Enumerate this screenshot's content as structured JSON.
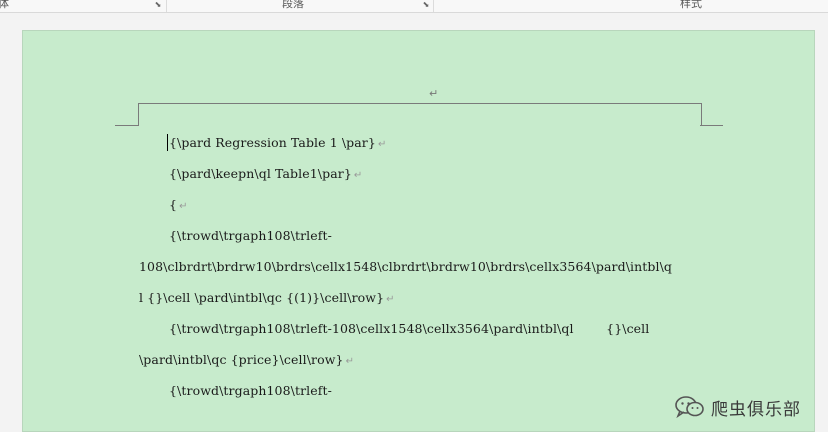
{
  "ribbon": {
    "groups": [
      {
        "label": "体"
      },
      {
        "label": "段落"
      },
      {
        "label": "样式"
      }
    ]
  },
  "document": {
    "header_mark": "↵",
    "lines": [
      {
        "text": "{\\pard Regression Table 1 \\par}",
        "indent": true
      },
      {
        "text": "{\\pard\\keepn\\ql Table1\\par}",
        "indent": true
      },
      {
        "text": "{",
        "indent": true
      },
      {
        "text": "{\\trowd\\trgaph108\\trleft-",
        "indent": true,
        "no_mark": true
      },
      {
        "text": "108\\clbrdrt\\brdrw10\\brdrs\\cellx1548\\clbrdrt\\brdrw10\\brdrs\\cellx3564\\pard\\intbl\\q",
        "indent": false,
        "no_mark": true
      },
      {
        "text": "l {}\\cell \\pard\\intbl\\qc {(1)}\\cell\\row}",
        "indent": false
      },
      {
        "text": "{\\trowd\\trgaph108\\trleft-108\\cellx1548\\cellx3564\\pard\\intbl\\ql        {}\\cell",
        "indent": true,
        "no_mark": true
      },
      {
        "text": "\\pard\\intbl\\qc {price}\\cell\\row}",
        "indent": false
      },
      {
        "text": "{\\trowd\\trgaph108\\trleft-",
        "indent": true,
        "no_mark": true
      }
    ],
    "paragraph_mark": "↵"
  },
  "watermark": {
    "text": "爬虫俱乐部",
    "icon": "wechat-icon"
  },
  "colors": {
    "page_background": "#c7ebcc",
    "app_background": "#f3f3f3"
  }
}
